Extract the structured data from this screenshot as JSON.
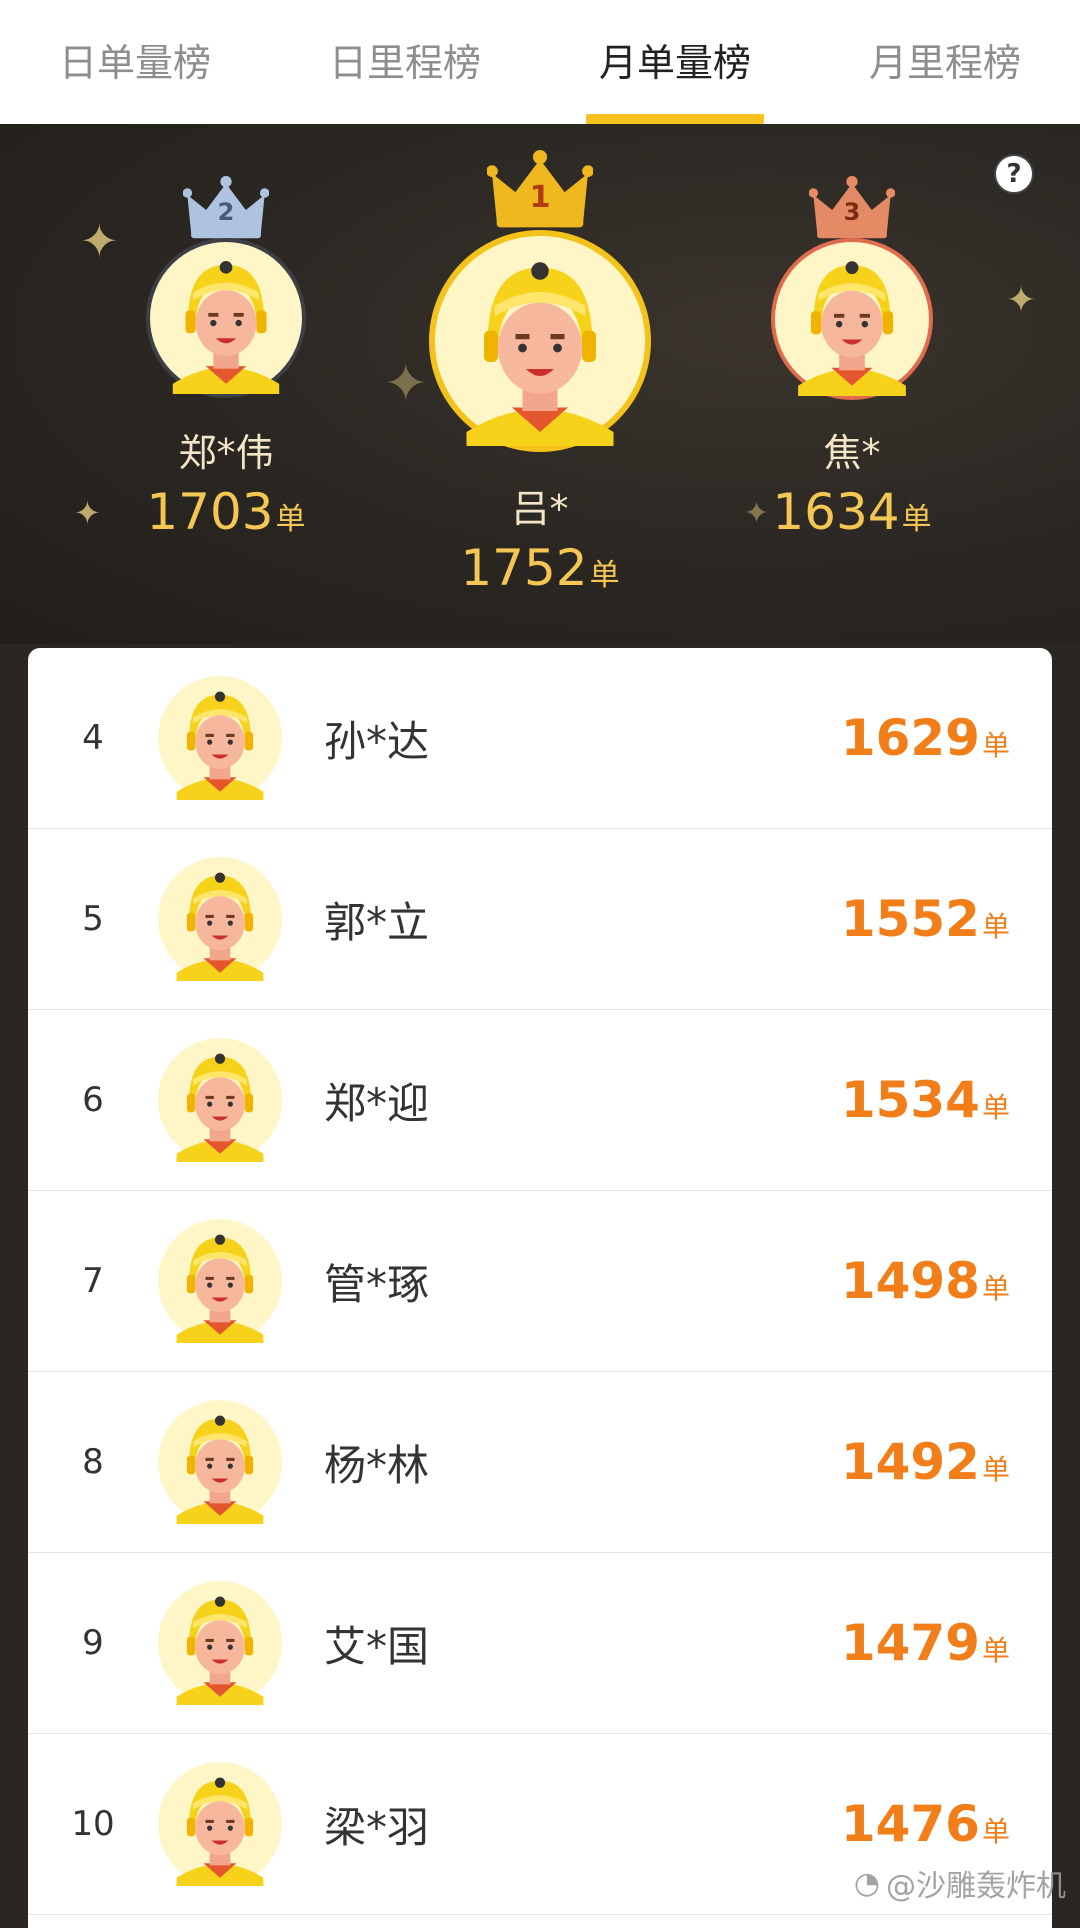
{
  "tabs": [
    {
      "label": "日单量榜"
    },
    {
      "label": "日里程榜"
    },
    {
      "label": "月单量榜",
      "active": true
    },
    {
      "label": "月里程榜"
    }
  ],
  "podium": {
    "help_label": "?",
    "first": {
      "rank": "1",
      "name": "吕*",
      "count": "1752",
      "unit": "单"
    },
    "second": {
      "rank": "2",
      "name": "郑*伟",
      "count": "1703",
      "unit": "单"
    },
    "third": {
      "rank": "3",
      "name": "焦*",
      "count": "1634",
      "unit": "单"
    }
  },
  "ranking": [
    {
      "rank": "4",
      "name": "孙*达",
      "count": "1629",
      "unit": "单"
    },
    {
      "rank": "5",
      "name": "郭*立",
      "count": "1552",
      "unit": "单"
    },
    {
      "rank": "6",
      "name": "郑*迎",
      "count": "1534",
      "unit": "单"
    },
    {
      "rank": "7",
      "name": "管*琢",
      "count": "1498",
      "unit": "单"
    },
    {
      "rank": "8",
      "name": "杨*林",
      "count": "1492",
      "unit": "单"
    },
    {
      "rank": "9",
      "name": "艾*国",
      "count": "1479",
      "unit": "单"
    },
    {
      "rank": "10",
      "name": "梁*羽",
      "count": "1476",
      "unit": "单"
    }
  ],
  "watermark": {
    "text": "@沙雕轰炸机"
  },
  "colors": {
    "accent": "#f5c21b",
    "count": "#f27e1a",
    "gold": "#f4c654",
    "silver": "#9fb6d4",
    "bronze": "#e07a55"
  }
}
